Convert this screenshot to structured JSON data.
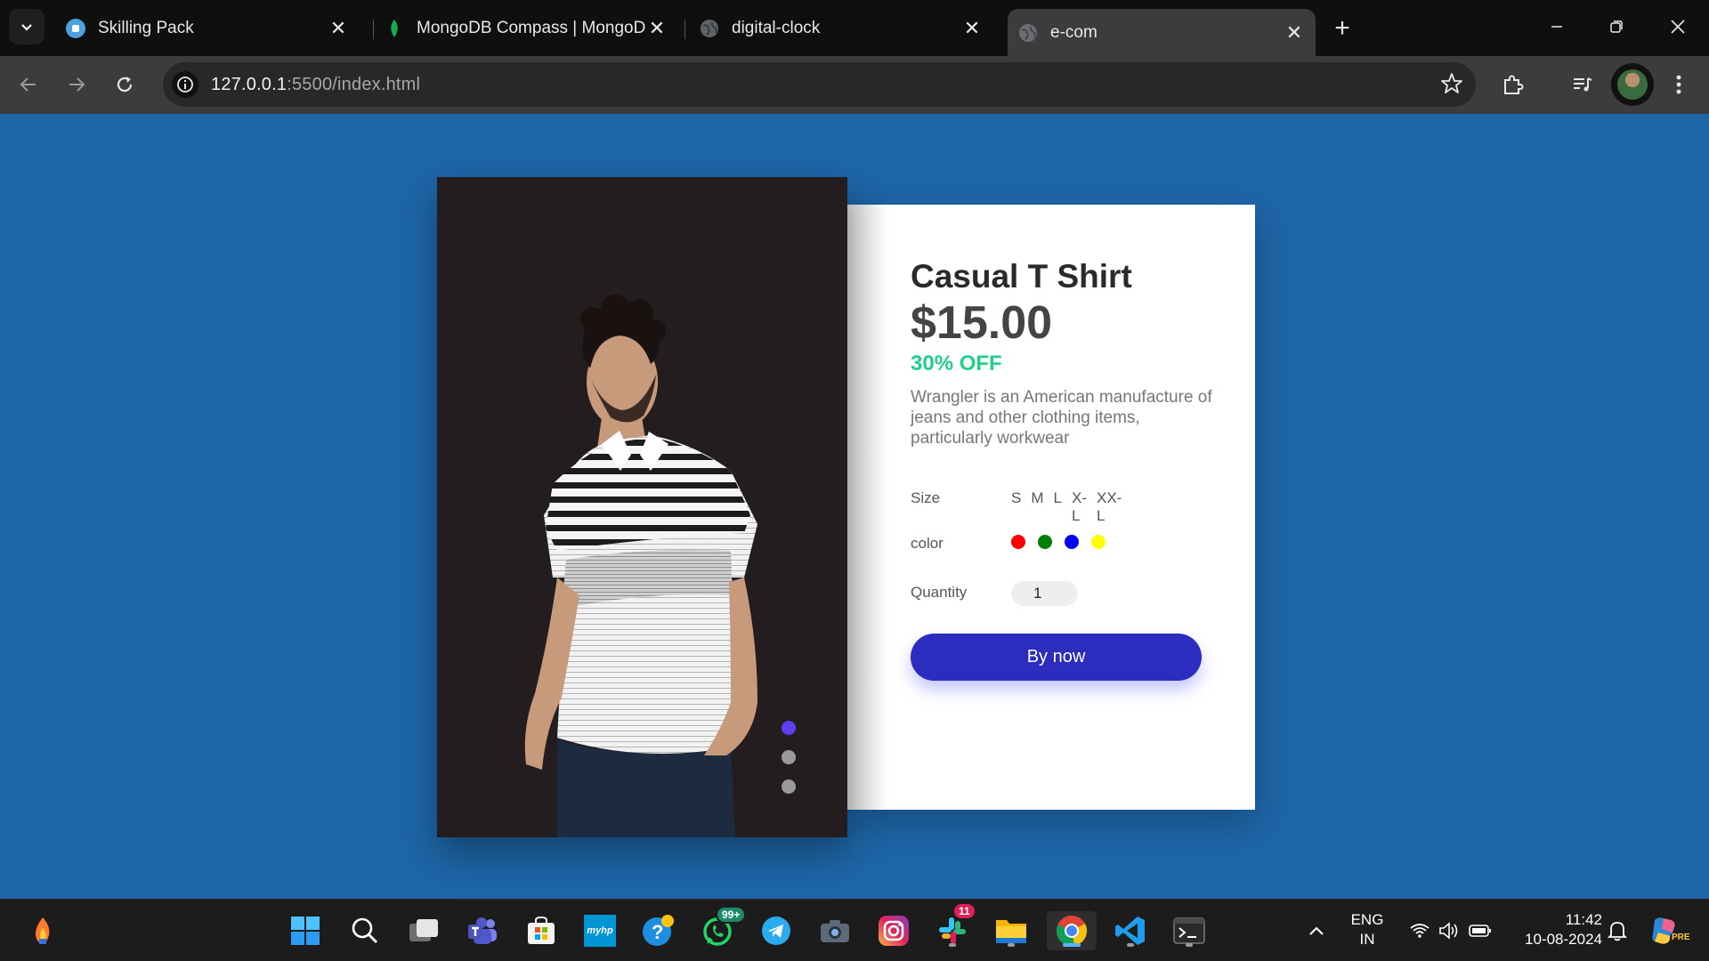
{
  "browser": {
    "tabs": [
      {
        "title": "Skilling Pack",
        "favicon": "skilling-pack-icon"
      },
      {
        "title": "MongoDB Compass | MongoDB",
        "favicon": "mongodb-leaf-icon"
      },
      {
        "title": "digital-clock",
        "favicon": "globe-icon"
      },
      {
        "title": "e-com",
        "favicon": "globe-icon",
        "active": true
      }
    ],
    "url_host": "127.0.0.1",
    "url_rest": ":5500/index.html"
  },
  "product": {
    "name": "Casual T Shirt",
    "price": "$15.00",
    "discount": "30% OFF",
    "description": "Wrangler is an American manufacture of jeans and other clothing items, particularly workwear",
    "size_label": "Size",
    "sizes": [
      "S",
      "M",
      "L",
      "X-L",
      "XX-L"
    ],
    "color_label": "color",
    "colors": [
      "#ff0000",
      "#008000",
      "#0000ff",
      "#ffff00"
    ],
    "quantity_label": "Quantity",
    "quantity": "1",
    "buy_label": "By now",
    "carousel_dot_colors": [
      "#5b3ff0",
      "#9a9a9a",
      "#9a9a9a"
    ]
  },
  "taskbar": {
    "apps": [
      "windows-start-icon",
      "search-icon",
      "task-view-icon",
      "teams-icon",
      "ms-store-icon",
      "myhp-icon",
      "help-icon",
      "whatsapp-icon",
      "telegram-icon",
      "camera-icon",
      "instagram-icon",
      "slack-icon",
      "file-explorer-icon",
      "chrome-icon",
      "vscode-icon",
      "terminal-icon"
    ],
    "myhp_label": "myhp",
    "whatsapp_badge": "99+",
    "slack_badge": "11",
    "lang_line1": "ENG",
    "lang_line2": "IN",
    "time": "11:42",
    "date": "10-08-2024",
    "copilot_badge": "PRE"
  }
}
